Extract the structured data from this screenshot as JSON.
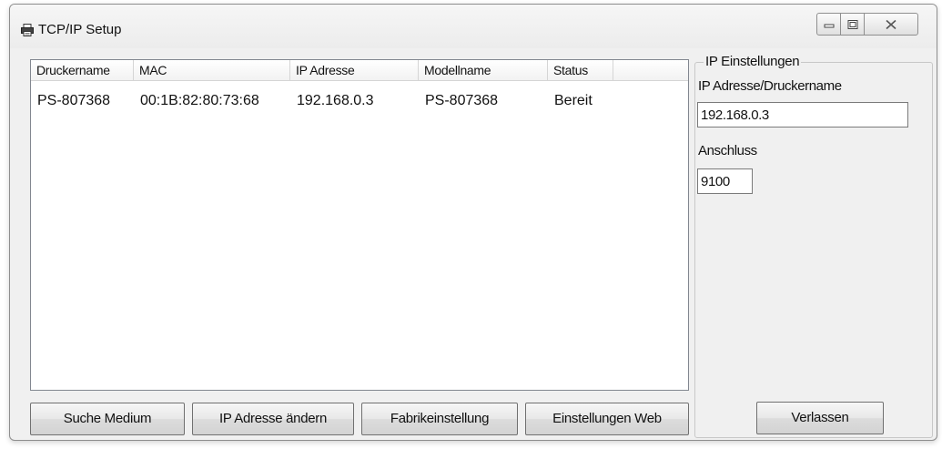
{
  "window": {
    "title": "TCP/IP Setup",
    "icon": "printer-icon"
  },
  "printer_list": {
    "columns": [
      "Druckername",
      "MAC",
      "IP Adresse",
      "Modellname",
      "Status"
    ],
    "rows": [
      [
        "PS-807368",
        "00:1B:82:80:73:68",
        "192.168.0.3",
        "PS-807368",
        "Bereit"
      ]
    ]
  },
  "buttons": {
    "search": "Suche Medium",
    "change_ip": "IP Adresse ändern",
    "factory": "Fabrikeinstellung",
    "web": "Einstellungen Web",
    "exit": "Verlassen"
  },
  "ip_settings": {
    "group_label": "IP Einstellungen",
    "address_label": "IP Adresse/Druckername",
    "address_value": "192.168.0.3",
    "port_label": "Anschluss",
    "port_value": "9100"
  }
}
